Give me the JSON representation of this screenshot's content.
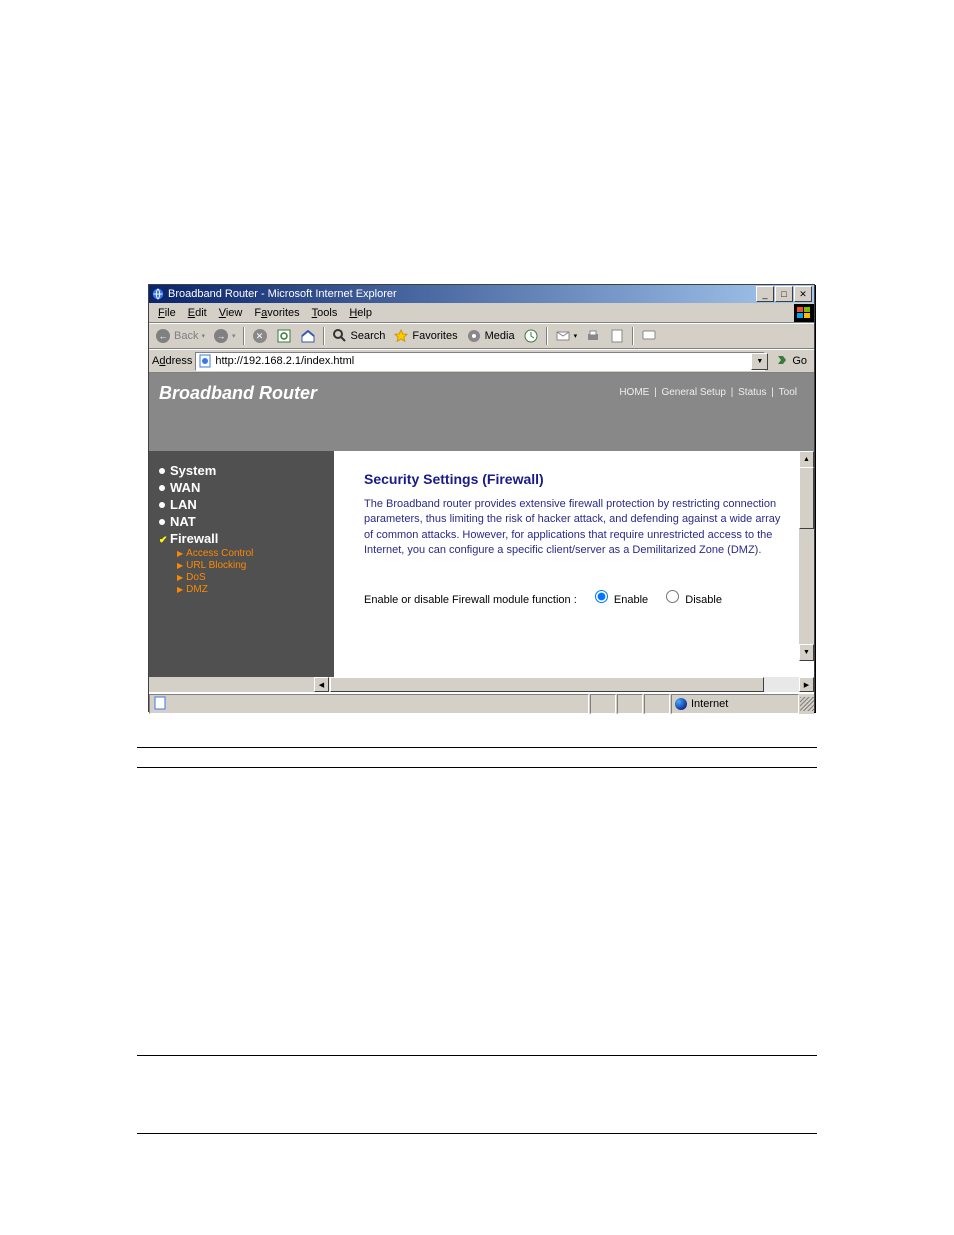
{
  "titlebar": {
    "title": "Broadband Router - Microsoft Internet Explorer"
  },
  "menu": {
    "file": "File",
    "edit": "Edit",
    "view": "View",
    "favorites": "Favorites",
    "tools": "Tools",
    "help": "Help"
  },
  "toolbar": {
    "back": "Back",
    "search": "Search",
    "favorites": "Favorites",
    "media": "Media"
  },
  "address": {
    "label": "Address",
    "url": "http://192.168.2.1/index.html",
    "go": "Go"
  },
  "banner": {
    "title": "Broadband Router",
    "links": {
      "home": "HOME",
      "general": "General Setup",
      "status": "Status",
      "tool": "Tool"
    }
  },
  "sidebar": {
    "items": [
      {
        "label": "System"
      },
      {
        "label": "WAN"
      },
      {
        "label": "LAN"
      },
      {
        "label": "NAT"
      },
      {
        "label": "Firewall"
      }
    ],
    "sub": [
      {
        "label": "Access Control"
      },
      {
        "label": "URL Blocking"
      },
      {
        "label": "DoS"
      },
      {
        "label": "DMZ"
      }
    ]
  },
  "main": {
    "heading": "Security Settings (Firewall)",
    "desc": "The Broadband router provides extensive firewall protection by restricting connection parameters, thus limiting the risk of hacker attack, and defending against a wide array of common attacks. However, for applications that require unrestricted access to the Internet, you can configure a specific client/server as a Demilitarized Zone (DMZ).",
    "prompt": "Enable or disable Firewall module function :",
    "opt_enable": "Enable",
    "opt_disable": "Disable"
  },
  "status": {
    "zone": "Internet"
  }
}
